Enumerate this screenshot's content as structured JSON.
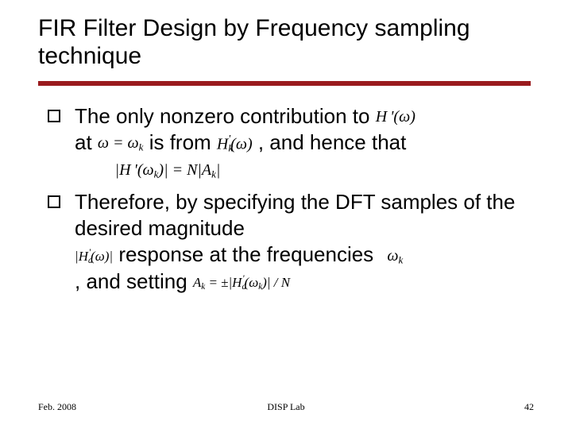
{
  "title": "FIR Filter Design by Frequency sampling technique",
  "bullets": [
    {
      "t1": "The only nonzero contribution to ",
      "eq1": "H '(ω)",
      "t2": " at ",
      "eq2": "ω = ω_k",
      "t3": " is from ",
      "eq3": "H'_k(ω)",
      "t4": " , and hence that ",
      "eq4": "|H '(ω_k)| = N |A_k|"
    },
    {
      "t1": "Therefore, by specifying the DFT samples of the desired magnitude ",
      "eq1": "|H'_d(ω)|",
      "t2": " response  at the frequencies ",
      "eq2": "ω_k",
      "t3": " , and setting ",
      "eq3": "A_k = ± |H'_d(ω_k)| / N"
    }
  ],
  "footer": {
    "left": "Feb. 2008",
    "mid": "DISP Lab",
    "right": "42"
  }
}
